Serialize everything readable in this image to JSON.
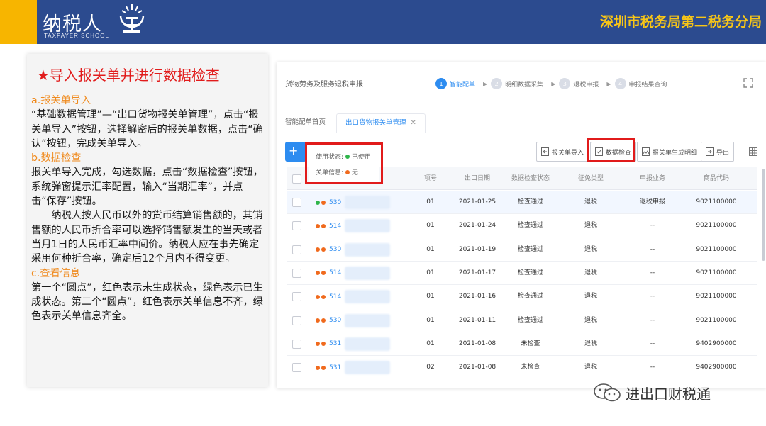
{
  "banner": {
    "logo_text": "纳税人",
    "logo_sub": "TAXPAYER SCHOOL",
    "logo_mark_char": "学堂",
    "right_title": "深圳市税务局第二税务分局",
    "colors": {
      "blue": "#2c4b8f",
      "yellow": "#f7b500",
      "gold_text": "#f7c518"
    }
  },
  "left": {
    "title": "★导入报关单并进行数据检查",
    "section_a_title": "a.报关单导入",
    "section_a_text": "“基础数据管理”—“出口货物报关单管理”，点击“报关单导入”按钮，选择解密后的报关单数据，点击“确认”按钮，完成关单导入。",
    "section_b_title": "b.数据检查",
    "section_b_text": "报关单导入完成，勾选数据，点击“数据检查”按钮，系统弹窗提示汇率配置，输入“当期汇率”，并点击“保存”按钮。",
    "section_b_text2": "纳税人按人民币以外的货币结算销售额的，其销售额的人民币折合率可以选择销售额发生的当天或者当月1日的人民币汇率中间价。纳税人应在事先确定采用何种折合率，确定后12个月内不得变更。",
    "section_c_title": "c.查看信息",
    "section_c_text": "第一个“圆点”，红色表示未生成状态，绿色表示已生成状态。第二个“圆点”，红色表示关单信息不齐，绿色表示关单信息齐全。"
  },
  "app": {
    "title": "货物劳务及服务退税申报",
    "steps": [
      {
        "num": "1",
        "label": "智能配单"
      },
      {
        "num": "2",
        "label": "明细数据采集"
      },
      {
        "num": "3",
        "label": "退税申报"
      },
      {
        "num": "4",
        "label": "申报结果查询"
      }
    ],
    "tabs": [
      {
        "label": "智能配单首页"
      },
      {
        "label": "出口货物报关单管理"
      }
    ],
    "toolbar": {
      "add_label": "+",
      "buttons": [
        {
          "label": "报关单导入"
        },
        {
          "label": "数据检查"
        },
        {
          "label": "报关单生成明细"
        },
        {
          "label": "导出"
        }
      ]
    },
    "legend": {
      "status_label": "使用状态:",
      "status_value": "已使用",
      "info_label": "关单信息:",
      "info_value": "无"
    },
    "columns": [
      "项号",
      "出口日期",
      "数据检查状态",
      "征免类型",
      "申报业务",
      "商品代码"
    ],
    "rows": [
      {
        "dot1": "#2fb54a",
        "dot2": "#f06a1d",
        "num": "530",
        "item": "01",
        "date": "2021-01-25",
        "check": "检查通过",
        "tax": "退税",
        "biz": "退税申报",
        "code": "9021100000"
      },
      {
        "dot1": "#f06a1d",
        "dot2": "#f06a1d",
        "num": "514",
        "item": "01",
        "date": "2021-01-24",
        "check": "检查通过",
        "tax": "退税",
        "biz": "--",
        "code": "9021100000"
      },
      {
        "dot1": "#f06a1d",
        "dot2": "#f06a1d",
        "num": "530",
        "item": "01",
        "date": "2021-01-19",
        "check": "检查通过",
        "tax": "退税",
        "biz": "--",
        "code": "9021100000"
      },
      {
        "dot1": "#f06a1d",
        "dot2": "#f06a1d",
        "num": "514",
        "item": "01",
        "date": "2021-01-17",
        "check": "检查通过",
        "tax": "退税",
        "biz": "--",
        "code": "9021100000"
      },
      {
        "dot1": "#f06a1d",
        "dot2": "#f06a1d",
        "num": "514",
        "item": "01",
        "date": "2021-01-16",
        "check": "检查通过",
        "tax": "退税",
        "biz": "--",
        "code": "9021100000"
      },
      {
        "dot1": "#f06a1d",
        "dot2": "#f06a1d",
        "num": "530",
        "item": "01",
        "date": "2021-01-11",
        "check": "检查通过",
        "tax": "退税",
        "biz": "--",
        "code": "9021100000"
      },
      {
        "dot1": "#f06a1d",
        "dot2": "#f06a1d",
        "num": "531",
        "item": "01",
        "date": "2021-01-08",
        "check": "未检查",
        "tax": "退税",
        "biz": "--",
        "code": "9402900000"
      },
      {
        "dot1": "#f06a1d",
        "dot2": "#f06a1d",
        "num": "531",
        "item": "02",
        "date": "2021-01-08",
        "check": "未检查",
        "tax": "退税",
        "biz": "--",
        "code": "9402900000"
      }
    ],
    "colors": {
      "accent": "#2d8cf0",
      "highlight_red": "#e11b1b",
      "dot_green": "#2fb54a",
      "dot_red": "#f06a1d"
    }
  },
  "watermark": {
    "text": "进出口财税通"
  }
}
